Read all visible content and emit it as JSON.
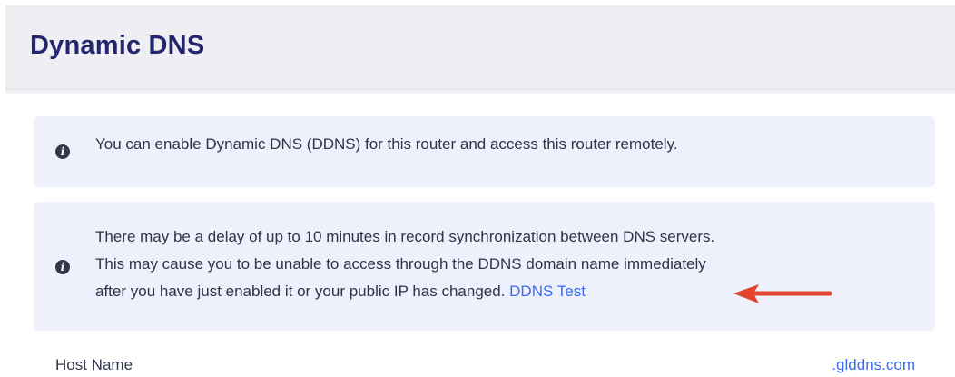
{
  "header": {
    "title": "Dynamic DNS"
  },
  "notices": {
    "enable": {
      "icon": "info-icon",
      "text": "You can enable Dynamic DNS (DDNS) for this router and access this router remotely."
    },
    "delay": {
      "icon": "info-icon",
      "line1": "There may be a delay of up to 10 minutes in record synchronization between DNS servers.",
      "line2": "This may cause you to be unable to access through the DDNS domain name immediately",
      "line3": "after you have just enabled it or your public IP has changed.",
      "link_label": "DDNS Test"
    }
  },
  "annotation": {
    "icon": "red-arrow-icon",
    "color": "#e2432c"
  },
  "host": {
    "label": "Host Name",
    "suffix": ".glddns.com"
  },
  "colors": {
    "title": "#23256e",
    "link": "#3b6cf0",
    "notice_bg": "#eef1fc",
    "header_bg": "#efeff3"
  }
}
